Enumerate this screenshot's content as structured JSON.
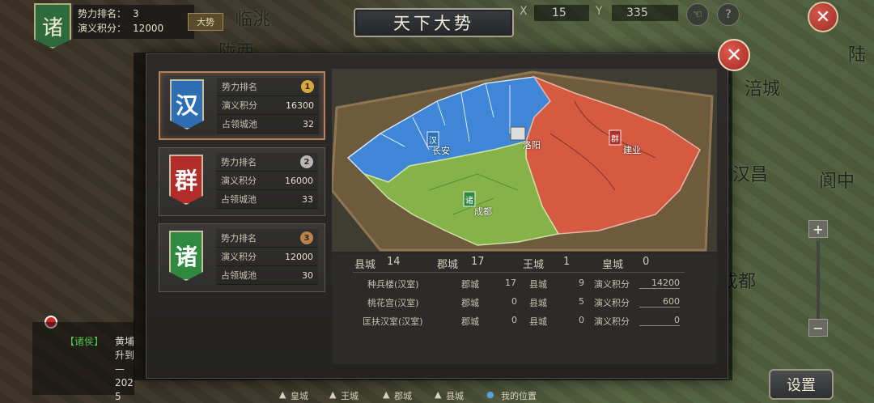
{
  "hud": {
    "faction_glyph": "诸",
    "rank_label": "势力排名：",
    "rank_value": "3",
    "score_label": "演义积分：",
    "score_value": "12000",
    "btn_label": "大势",
    "x_label": "X",
    "x_value": "15",
    "y_label": "Y",
    "y_value": "335"
  },
  "map_labels": [
    "临洮",
    "陇西",
    "涪城",
    "汉昌",
    "阆中",
    "成都",
    "陆"
  ],
  "modal": {
    "title": "天下大势",
    "close_icon": "✕"
  },
  "factions": [
    {
      "glyph": "汉",
      "color": "#2e6fb3",
      "rank_label": "势力排名",
      "rank": "1",
      "badge_color": "#d7a83a",
      "score_label": "演义积分",
      "score": "16300",
      "cities_label": "占领城池",
      "cities": "32"
    },
    {
      "glyph": "群",
      "color": "#b22d2a",
      "rank_label": "势力排名",
      "rank": "2",
      "badge_color": "#b8b8b8",
      "score_label": "演义积分",
      "score": "16000",
      "cities_label": "占领城池",
      "cities": "33"
    },
    {
      "glyph": "诸",
      "color": "#2f8a3f",
      "rank_label": "势力排名",
      "rank": "3",
      "badge_color": "#b8824a",
      "score_label": "演义积分",
      "score": "12000",
      "cities_label": "占领城池",
      "cities": "30"
    }
  ],
  "map_cities": [
    {
      "name": "长安",
      "flag": "汉"
    },
    {
      "name": "洛阳",
      "flag": ""
    },
    {
      "name": "建业",
      "flag": "群"
    },
    {
      "name": "成都",
      "flag": "诸"
    }
  ],
  "summary": {
    "county_label": "县城",
    "county": "14",
    "prefecture_label": "郡城",
    "prefecture": "17",
    "kingcity_label": "王城",
    "kingcity": "1",
    "imperial_label": "皇城",
    "imperial": "0"
  },
  "rows": [
    {
      "name": "种兵楼(汉室)",
      "pref_label": "郡城",
      "pref": "17",
      "county_label": "县城",
      "county": "9",
      "score_label": "演义积分",
      "score": "14200"
    },
    {
      "name": "桃花宫(汉室)",
      "pref_label": "郡城",
      "pref": "0",
      "county_label": "县城",
      "county": "5",
      "score_label": "演义积分",
      "score": "600"
    },
    {
      "name": "匡扶汉室(汉室)",
      "pref_label": "郡城",
      "pref": "0",
      "county_label": "县城",
      "county": "0",
      "score_label": "演义积分",
      "score": "0"
    }
  ],
  "legend": {
    "imperial": "皇城",
    "king": "王城",
    "pref": "郡城",
    "county": "县城",
    "mypos": "我的位置"
  },
  "chat": {
    "tag": "【诸侯】",
    "line1": "黄埔",
    "line2": "升到",
    "line3": "—202",
    "line4": "5"
  },
  "settings_label": "设置",
  "zoom_in": "+",
  "zoom_out": "−"
}
